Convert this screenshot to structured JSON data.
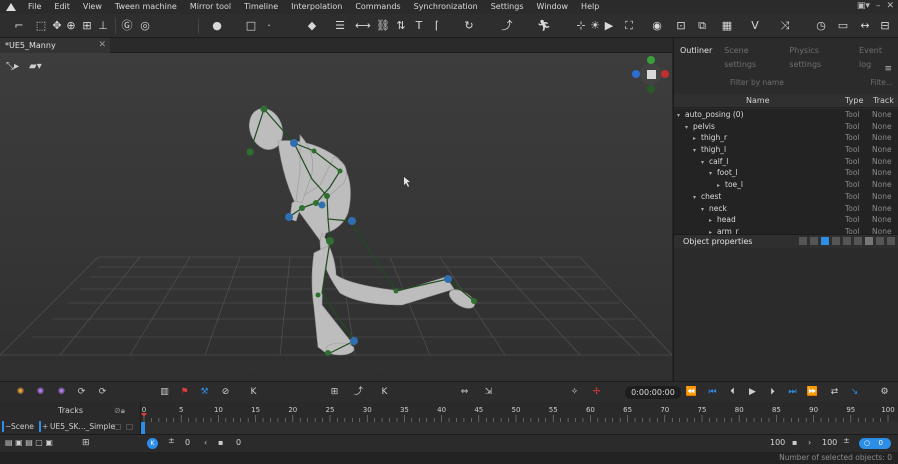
{
  "menu": [
    "File",
    "Edit",
    "View",
    "Tween machine",
    "Mirror tool",
    "Timeline",
    "Interpolation",
    "Commands",
    "Synchronization",
    "Settings",
    "Window",
    "Help"
  ],
  "document_tab": {
    "label": "*UE5_Manny",
    "close": "✕"
  },
  "panel_tabs": [
    "Outliner",
    "Scene settings",
    "Physics settings",
    "Event log"
  ],
  "filter": {
    "name_placeholder": "Filter by name",
    "extra_placeholder": "Filte..."
  },
  "columns": {
    "name": "Name",
    "type": "Type",
    "track": "Track"
  },
  "tree": [
    {
      "depth": 0,
      "label": "auto_posing (0)",
      "arrow": "▾",
      "type": "Tool",
      "track": "None"
    },
    {
      "depth": 1,
      "label": "pelvis",
      "arrow": "▾",
      "type": "Tool",
      "track": "None"
    },
    {
      "depth": 2,
      "label": "thigh_r",
      "arrow": "▸",
      "type": "Tool",
      "track": "None"
    },
    {
      "depth": 2,
      "label": "thigh_l",
      "arrow": "▾",
      "type": "Tool",
      "track": "None"
    },
    {
      "depth": 3,
      "label": "calf_l",
      "arrow": "▾",
      "type": "Tool",
      "track": "None"
    },
    {
      "depth": 4,
      "label": "foot_l",
      "arrow": "▾",
      "type": "Tool",
      "track": "None"
    },
    {
      "depth": 5,
      "label": "toe_l",
      "arrow": "▸",
      "type": "Tool",
      "track": "None"
    },
    {
      "depth": 2,
      "label": "chest",
      "arrow": "▾",
      "type": "Tool",
      "track": "None"
    },
    {
      "depth": 3,
      "label": "neck",
      "arrow": "▾",
      "type": "Tool",
      "track": "None"
    },
    {
      "depth": 4,
      "label": "head",
      "arrow": "▸",
      "type": "Tool",
      "track": "None"
    },
    {
      "depth": 4,
      "label": "arm_r",
      "arrow": "▸",
      "type": "Tool",
      "track": "None"
    }
  ],
  "object_properties": "Object properties",
  "transport": {
    "time": "0:00:00:00"
  },
  "timeline": {
    "tracks_label": "Tracks",
    "scene_label": "Scene",
    "object_label": "UE5_SK..._Simple",
    "ticks": [
      "0",
      "5",
      "10",
      "15",
      "20",
      "25",
      "30",
      "35",
      "40",
      "45",
      "50",
      "55",
      "60",
      "65",
      "70",
      "75",
      "80",
      "85",
      "90",
      "95",
      "100"
    ],
    "range_start": "0",
    "range_current": "0",
    "range_end": "100",
    "range_end2": "100",
    "speed": "0"
  },
  "status": "Number of selected objects: 0",
  "colors": {
    "accent": "#2d8ee8",
    "joint_green": "#2f6f2f",
    "joint_blue": "#2f6fb0",
    "keyframe_red": "#e03a3a"
  }
}
